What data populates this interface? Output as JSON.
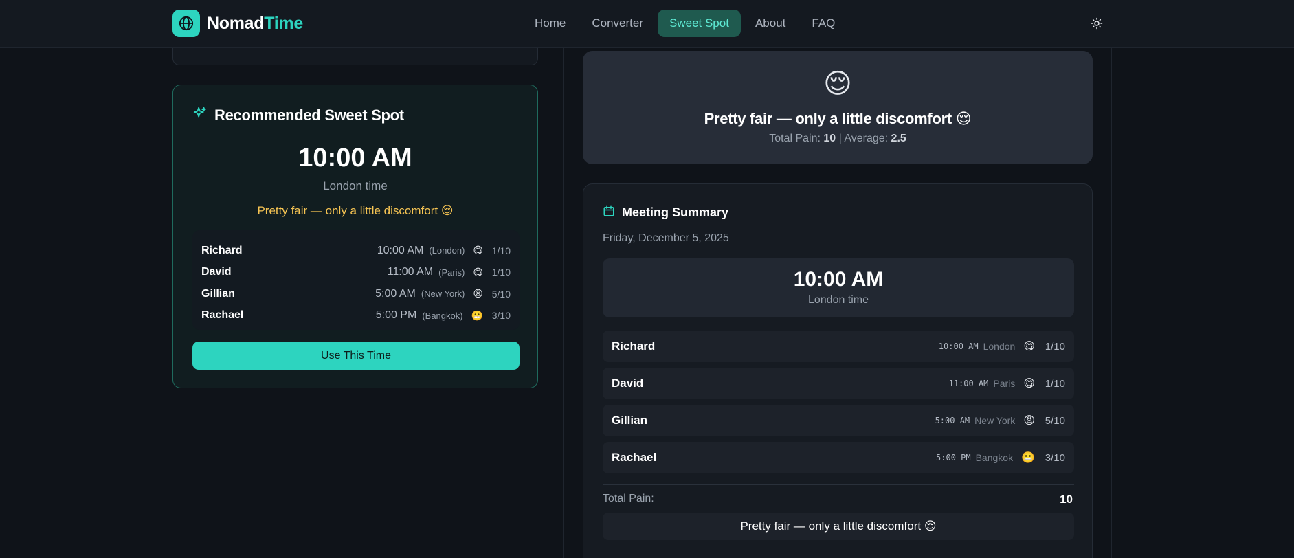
{
  "header": {
    "logo_part1": "Nomad",
    "logo_part2": "Time",
    "logo_icon": "globe-icon",
    "nav": [
      {
        "label": "Home"
      },
      {
        "label": "Converter"
      },
      {
        "label": "Sweet Spot",
        "active": true
      },
      {
        "label": "About"
      },
      {
        "label": "FAQ"
      }
    ],
    "theme_icon": "sun-icon"
  },
  "recommended": {
    "title": "Recommended Sweet Spot",
    "icon": "sparkles-icon",
    "time": "10:00 AM",
    "zone": "London time",
    "verdict": "Pretty fair — only a little discomfort 😌",
    "participants": [
      {
        "name": "Richard",
        "time": "10:00 AM",
        "city": "(London)",
        "emoji": "😋",
        "score": "1/10"
      },
      {
        "name": "David",
        "time": "11:00 AM",
        "city": "(Paris)",
        "emoji": "😋",
        "score": "1/10"
      },
      {
        "name": "Gillian",
        "time": "5:00 AM",
        "city": "(New York)",
        "emoji": "😩",
        "score": "5/10"
      },
      {
        "name": "Rachael",
        "time": "5:00 PM",
        "city": "(Bangkok)",
        "emoji": "😬",
        "score": "3/10"
      }
    ],
    "button_label": "Use This Time"
  },
  "fairness": {
    "emoji": "😌",
    "title": "Pretty fair — only a little discomfort 😌",
    "total_label": "Total Pain:",
    "total_value": "10",
    "avg_label": "| Average:",
    "avg_value": "2.5"
  },
  "summary": {
    "title": "Meeting Summary",
    "icon": "calendar-icon",
    "date": "Friday, December 5, 2025",
    "time": "10:00 AM",
    "zone": "London time",
    "participants": [
      {
        "name": "Richard",
        "time": "10:00 AM",
        "city": "London",
        "emoji": "😋",
        "score": "1/10"
      },
      {
        "name": "David",
        "time": "11:00 AM",
        "city": "Paris",
        "emoji": "😋",
        "score": "1/10"
      },
      {
        "name": "Gillian",
        "time": "5:00 AM",
        "city": "New York",
        "emoji": "😩",
        "score": "5/10"
      },
      {
        "name": "Rachael",
        "time": "5:00 PM",
        "city": "Bangkok",
        "emoji": "😬",
        "score": "3/10"
      }
    ],
    "total_label": "Total Pain:",
    "total_value": "10",
    "verdict": "Pretty fair — only a little discomfort 😌"
  },
  "colors": {
    "accent": "#2dd4bf",
    "verdict": "#f6c453",
    "background": "#0f1319"
  }
}
